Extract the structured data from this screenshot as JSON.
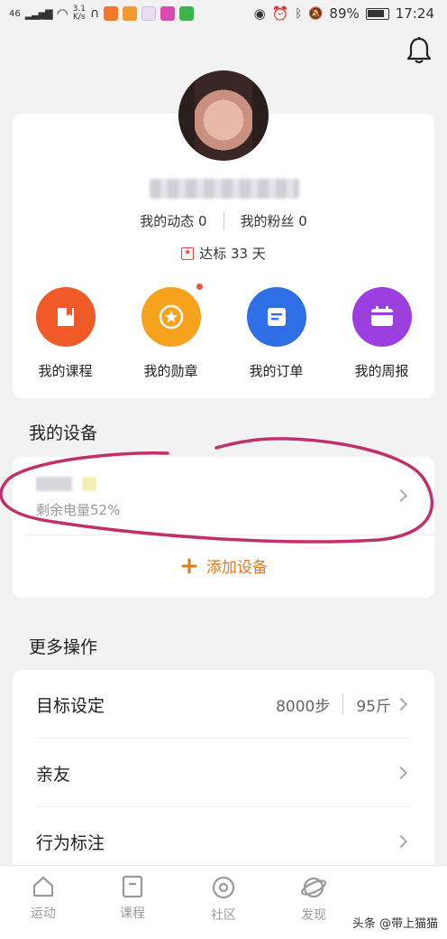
{
  "status_bar": {
    "signal": "46",
    "net_speed_value": "3.1",
    "net_speed_unit": "K/s",
    "battery": "89%",
    "time": "17:24"
  },
  "profile": {
    "dynamics_label": "我的动态 0",
    "fans_label": "我的粉丝 0",
    "streak_label": "达标 33 天",
    "streak_icon": "★"
  },
  "quick_actions": [
    {
      "label": "我的课程",
      "color": "#f05a28",
      "icon": "book-icon"
    },
    {
      "label": "我的勋章",
      "color": "#f6a21c",
      "icon": "medal-icon"
    },
    {
      "label": "我的订单",
      "color": "#2e6fe6",
      "icon": "order-icon"
    },
    {
      "label": "我的周报",
      "color": "#9b3fe0",
      "icon": "calendar-icon"
    }
  ],
  "devices": {
    "title": "我的设备",
    "battery_text": "剩余电量52%",
    "add_label": "添加设备",
    "add_icon": "+"
  },
  "more": {
    "title": "更多操作",
    "rows": [
      {
        "label": "目标设定",
        "steps": "8000步",
        "weight": "95斤"
      },
      {
        "label": "亲友"
      },
      {
        "label": "行为标注"
      }
    ]
  },
  "nav": [
    {
      "label": "运动",
      "icon": "home-icon"
    },
    {
      "label": "课程",
      "icon": "course-icon"
    },
    {
      "label": "社区",
      "icon": "community-icon"
    },
    {
      "label": "发现",
      "icon": "discover-icon"
    }
  ],
  "watermark": "头条 @带上猫猫",
  "colors": {
    "accent_orange": "#e07a1e",
    "annotation": "#c0306a"
  }
}
